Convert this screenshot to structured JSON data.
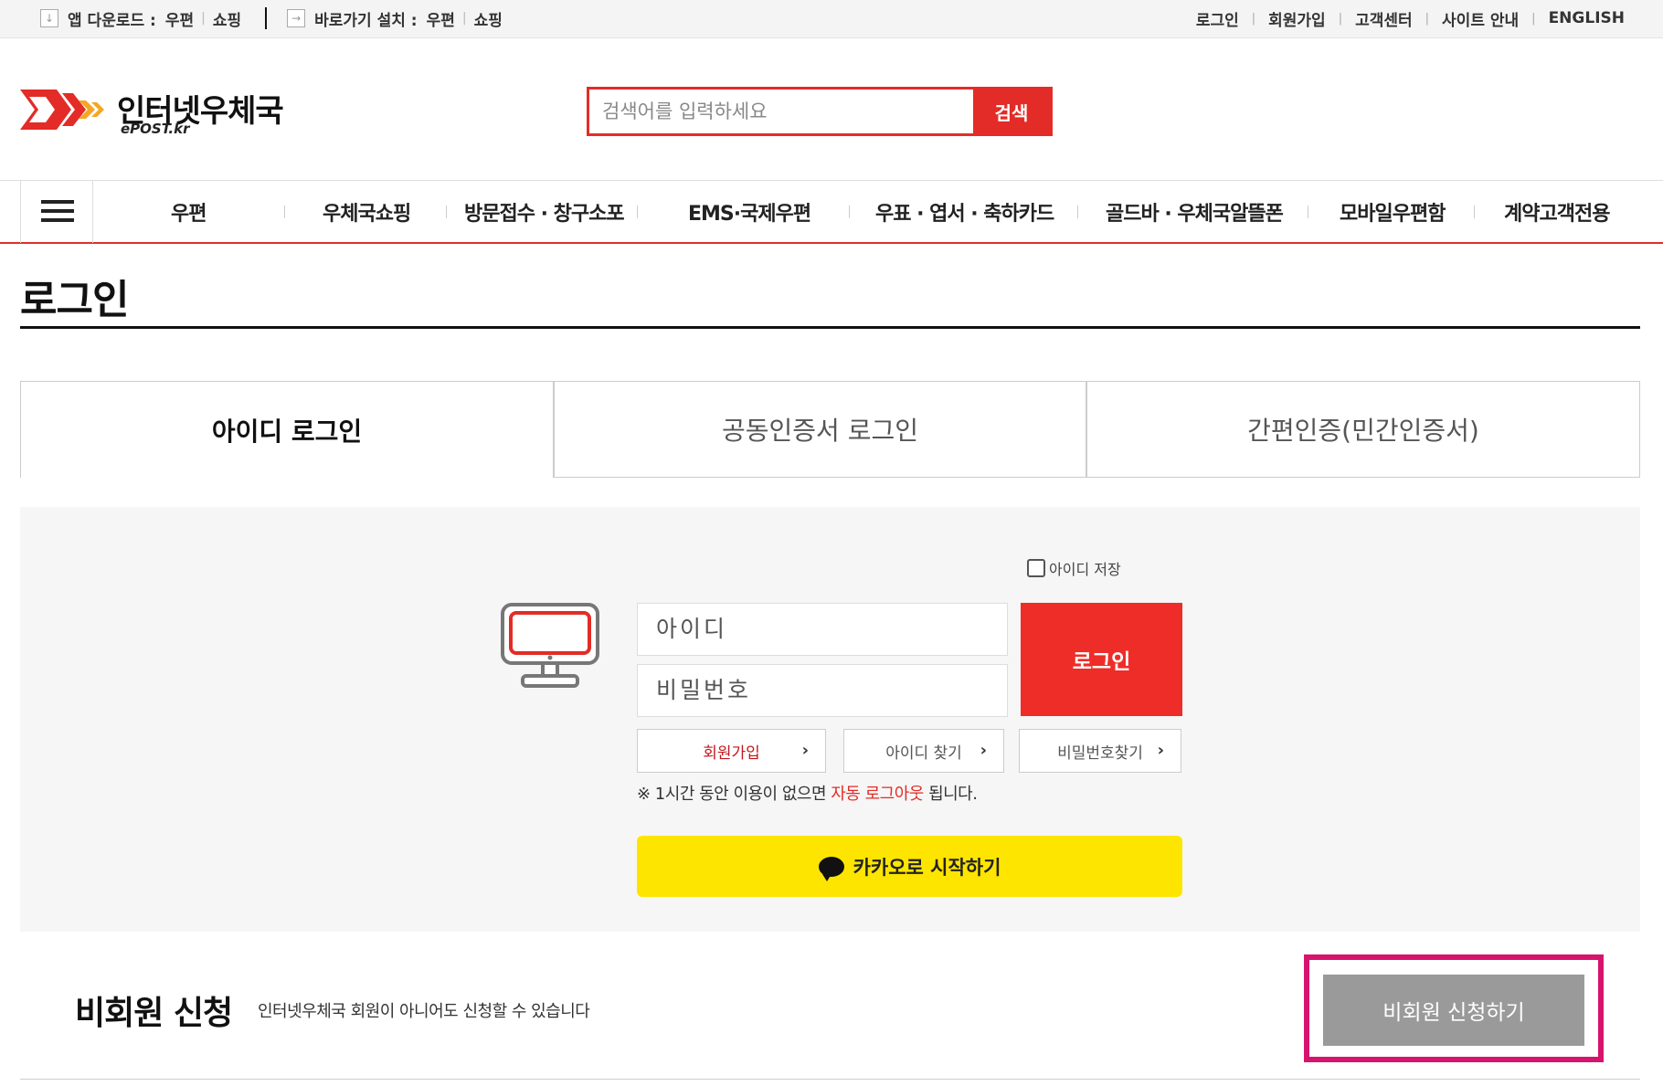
{
  "topbar": {
    "app_download_label": "앱 다운로드 :",
    "app_links": [
      "우편",
      "쇼핑"
    ],
    "shortcut_label": "바로가기 설치 :",
    "shortcut_links": [
      "우편",
      "쇼핑"
    ],
    "right_links": [
      "로그인",
      "회원가입",
      "고객센터",
      "사이트 안내",
      "ENGLISH"
    ]
  },
  "header": {
    "logo_text": "인터넷우체국",
    "logo_sub": "ePOST.kr",
    "search_placeholder": "검색어를 입력하세요",
    "search_button": "검색"
  },
  "gnb": {
    "items": [
      "우편",
      "우체국쇼핑",
      "방문접수 · 창구소포",
      "EMS·국제우편",
      "우표 · 엽서 · 축하카드",
      "골드바 · 우체국알뜰폰",
      "모바일우편함",
      "계약고객전용"
    ]
  },
  "page": {
    "title": "로그인"
  },
  "tabs": [
    "아이디 로그인",
    "공동인증서 로그인",
    "간편인증(민간인증서)"
  ],
  "login": {
    "save_id_label": "아이디 저장",
    "id_placeholder": "아이디",
    "pw_placeholder": "비밀번호",
    "login_button": "로그인",
    "signup": "회원가입",
    "find_id": "아이디 찾기",
    "find_pw": "비밀번호찾기",
    "notice_prefix": "※ 1시간 동안 이용이 없으면 ",
    "notice_highlight": "자동 로그아웃",
    "notice_suffix": " 됩니다.",
    "kakao_button": "카카오로 시작하기"
  },
  "nonmember": {
    "title": "비회원 신청",
    "description": "인터넷우체국 회원이 아니어도 신청할 수 있습니다",
    "button": "비회원 신청하기"
  },
  "colors": {
    "brand_red": "#e32c27",
    "kakao_yellow": "#fee500",
    "highlight_pink": "#d6146d"
  }
}
